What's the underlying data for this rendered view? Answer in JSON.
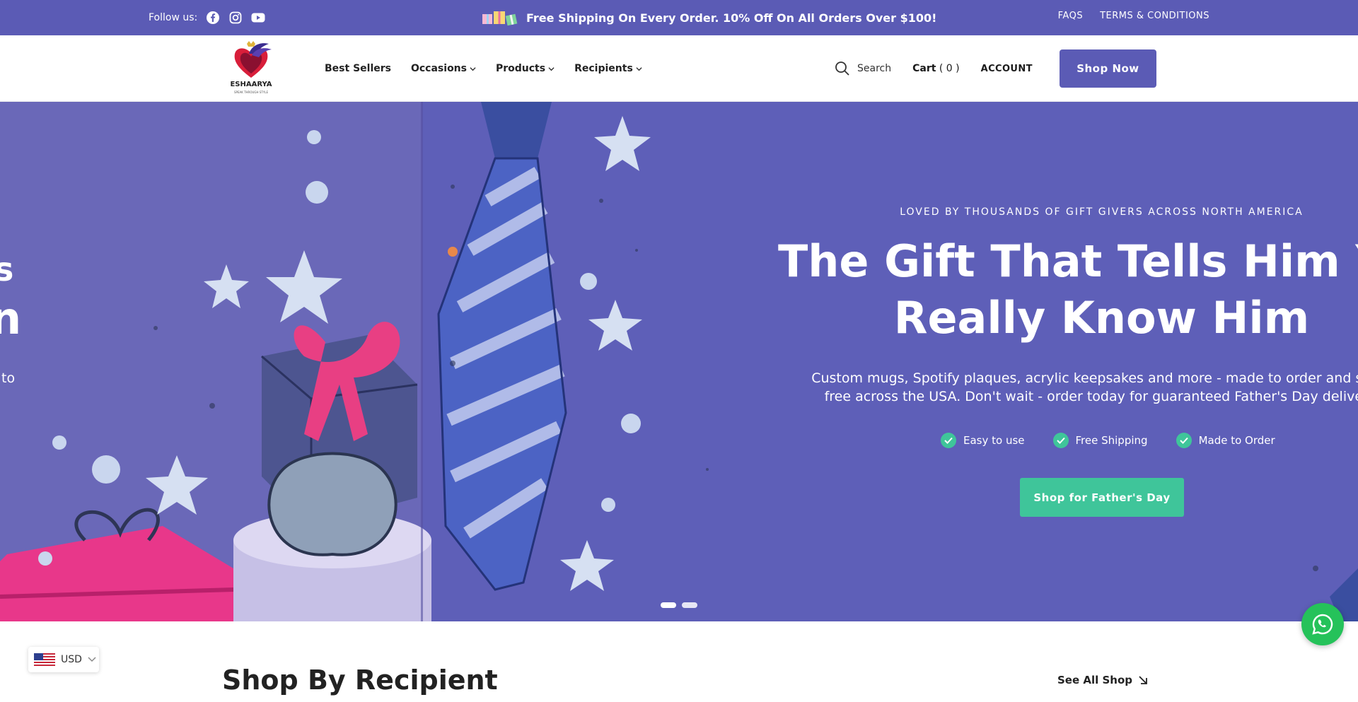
{
  "topbar": {
    "follow_label": "Follow us:",
    "social_icons": [
      "facebook-icon",
      "instagram-icon",
      "youtube-icon"
    ],
    "promo_text": "Free Shipping On Every Order. 10% Off On All Orders Over $100!",
    "links": [
      "FAQS",
      "TERMS & CONDITIONS"
    ],
    "bg_color": "#5b5bb5"
  },
  "header": {
    "logo_text": "ESHAARYA",
    "logo_tagline": "SPEAK THROUGH STYLE",
    "nav": [
      {
        "label": "Best Sellers",
        "has_dropdown": false
      },
      {
        "label": "Occasions",
        "has_dropdown": true
      },
      {
        "label": "Products",
        "has_dropdown": true
      },
      {
        "label": "Recipients",
        "has_dropdown": true
      }
    ],
    "search_label": "Search",
    "cart_label": "Cart",
    "cart_count": "( 0 )",
    "account_label": "ACCOUNT",
    "shop_now_label": "Shop Now"
  },
  "hero": {
    "prev_slide_fragments": [
      "s",
      "n",
      "to"
    ],
    "eyebrow": "LOVED BY THOUSANDS OF GIFT GIVERS ACROSS NORTH AMERICA",
    "headline_line1": "The Gift That Tells Him You",
    "headline_line2": "Really Know Him",
    "subcopy_line1": "Custom mugs, Spotify plaques, acrylic keepsakes and more - made to order and shipp",
    "subcopy_line2": "free across the USA. Don't wait - order today for guaranteed Father's Day delivery.",
    "features": [
      "Easy to use",
      "Free Shipping",
      "Made to Order"
    ],
    "cta_label": "Shop for Father's Day",
    "slide_count": 2,
    "bg_color": "#5e5fb8",
    "accent_color": "#3fc59a"
  },
  "section": {
    "title": "Shop By Recipient",
    "see_all_label": "See All Shop"
  },
  "currency": {
    "code": "USD"
  }
}
